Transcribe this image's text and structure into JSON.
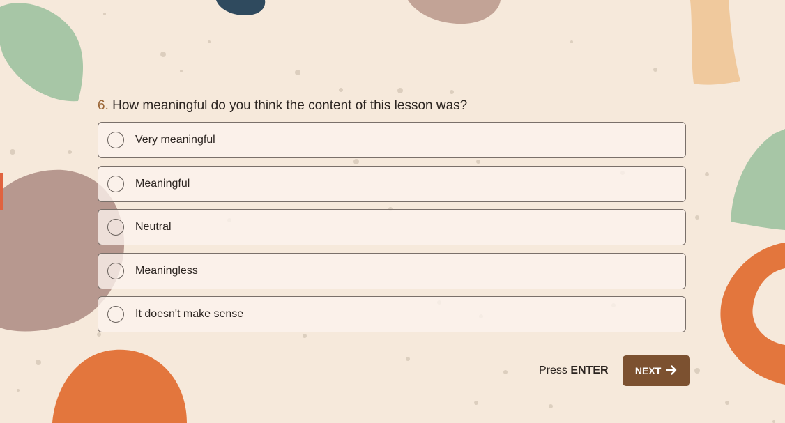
{
  "question": {
    "number": "6.",
    "text": "How meaningful do you think the content of this lesson was?"
  },
  "options": [
    {
      "label": "Very meaningful"
    },
    {
      "label": "Meaningful"
    },
    {
      "label": "Neutral"
    },
    {
      "label": "Meaningless"
    },
    {
      "label": "It doesn't make sense"
    }
  ],
  "footer": {
    "press_label": "Press",
    "enter_label": "ENTER",
    "next_label": "NEXT",
    "next_icon": "arrow-right-icon"
  },
  "colors": {
    "background": "#f6e9db",
    "accent_button": "#7c5130",
    "question_number": "#9a6535"
  }
}
